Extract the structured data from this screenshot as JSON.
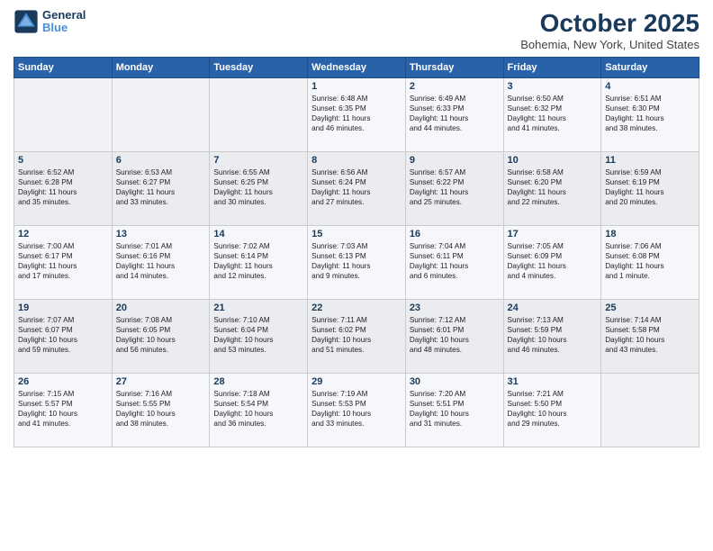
{
  "header": {
    "logo_line1": "General",
    "logo_line2": "Blue",
    "month": "October 2025",
    "location": "Bohemia, New York, United States"
  },
  "days_of_week": [
    "Sunday",
    "Monday",
    "Tuesday",
    "Wednesday",
    "Thursday",
    "Friday",
    "Saturday"
  ],
  "weeks": [
    [
      {
        "day": "",
        "text": ""
      },
      {
        "day": "",
        "text": ""
      },
      {
        "day": "",
        "text": ""
      },
      {
        "day": "1",
        "text": "Sunrise: 6:48 AM\nSunset: 6:35 PM\nDaylight: 11 hours\nand 46 minutes."
      },
      {
        "day": "2",
        "text": "Sunrise: 6:49 AM\nSunset: 6:33 PM\nDaylight: 11 hours\nand 44 minutes."
      },
      {
        "day": "3",
        "text": "Sunrise: 6:50 AM\nSunset: 6:32 PM\nDaylight: 11 hours\nand 41 minutes."
      },
      {
        "day": "4",
        "text": "Sunrise: 6:51 AM\nSunset: 6:30 PM\nDaylight: 11 hours\nand 38 minutes."
      }
    ],
    [
      {
        "day": "5",
        "text": "Sunrise: 6:52 AM\nSunset: 6:28 PM\nDaylight: 11 hours\nand 35 minutes."
      },
      {
        "day": "6",
        "text": "Sunrise: 6:53 AM\nSunset: 6:27 PM\nDaylight: 11 hours\nand 33 minutes."
      },
      {
        "day": "7",
        "text": "Sunrise: 6:55 AM\nSunset: 6:25 PM\nDaylight: 11 hours\nand 30 minutes."
      },
      {
        "day": "8",
        "text": "Sunrise: 6:56 AM\nSunset: 6:24 PM\nDaylight: 11 hours\nand 27 minutes."
      },
      {
        "day": "9",
        "text": "Sunrise: 6:57 AM\nSunset: 6:22 PM\nDaylight: 11 hours\nand 25 minutes."
      },
      {
        "day": "10",
        "text": "Sunrise: 6:58 AM\nSunset: 6:20 PM\nDaylight: 11 hours\nand 22 minutes."
      },
      {
        "day": "11",
        "text": "Sunrise: 6:59 AM\nSunset: 6:19 PM\nDaylight: 11 hours\nand 20 minutes."
      }
    ],
    [
      {
        "day": "12",
        "text": "Sunrise: 7:00 AM\nSunset: 6:17 PM\nDaylight: 11 hours\nand 17 minutes."
      },
      {
        "day": "13",
        "text": "Sunrise: 7:01 AM\nSunset: 6:16 PM\nDaylight: 11 hours\nand 14 minutes."
      },
      {
        "day": "14",
        "text": "Sunrise: 7:02 AM\nSunset: 6:14 PM\nDaylight: 11 hours\nand 12 minutes."
      },
      {
        "day": "15",
        "text": "Sunrise: 7:03 AM\nSunset: 6:13 PM\nDaylight: 11 hours\nand 9 minutes."
      },
      {
        "day": "16",
        "text": "Sunrise: 7:04 AM\nSunset: 6:11 PM\nDaylight: 11 hours\nand 6 minutes."
      },
      {
        "day": "17",
        "text": "Sunrise: 7:05 AM\nSunset: 6:09 PM\nDaylight: 11 hours\nand 4 minutes."
      },
      {
        "day": "18",
        "text": "Sunrise: 7:06 AM\nSunset: 6:08 PM\nDaylight: 11 hours\nand 1 minute."
      }
    ],
    [
      {
        "day": "19",
        "text": "Sunrise: 7:07 AM\nSunset: 6:07 PM\nDaylight: 10 hours\nand 59 minutes."
      },
      {
        "day": "20",
        "text": "Sunrise: 7:08 AM\nSunset: 6:05 PM\nDaylight: 10 hours\nand 56 minutes."
      },
      {
        "day": "21",
        "text": "Sunrise: 7:10 AM\nSunset: 6:04 PM\nDaylight: 10 hours\nand 53 minutes."
      },
      {
        "day": "22",
        "text": "Sunrise: 7:11 AM\nSunset: 6:02 PM\nDaylight: 10 hours\nand 51 minutes."
      },
      {
        "day": "23",
        "text": "Sunrise: 7:12 AM\nSunset: 6:01 PM\nDaylight: 10 hours\nand 48 minutes."
      },
      {
        "day": "24",
        "text": "Sunrise: 7:13 AM\nSunset: 5:59 PM\nDaylight: 10 hours\nand 46 minutes."
      },
      {
        "day": "25",
        "text": "Sunrise: 7:14 AM\nSunset: 5:58 PM\nDaylight: 10 hours\nand 43 minutes."
      }
    ],
    [
      {
        "day": "26",
        "text": "Sunrise: 7:15 AM\nSunset: 5:57 PM\nDaylight: 10 hours\nand 41 minutes."
      },
      {
        "day": "27",
        "text": "Sunrise: 7:16 AM\nSunset: 5:55 PM\nDaylight: 10 hours\nand 38 minutes."
      },
      {
        "day": "28",
        "text": "Sunrise: 7:18 AM\nSunset: 5:54 PM\nDaylight: 10 hours\nand 36 minutes."
      },
      {
        "day": "29",
        "text": "Sunrise: 7:19 AM\nSunset: 5:53 PM\nDaylight: 10 hours\nand 33 minutes."
      },
      {
        "day": "30",
        "text": "Sunrise: 7:20 AM\nSunset: 5:51 PM\nDaylight: 10 hours\nand 31 minutes."
      },
      {
        "day": "31",
        "text": "Sunrise: 7:21 AM\nSunset: 5:50 PM\nDaylight: 10 hours\nand 29 minutes."
      },
      {
        "day": "",
        "text": ""
      }
    ]
  ]
}
